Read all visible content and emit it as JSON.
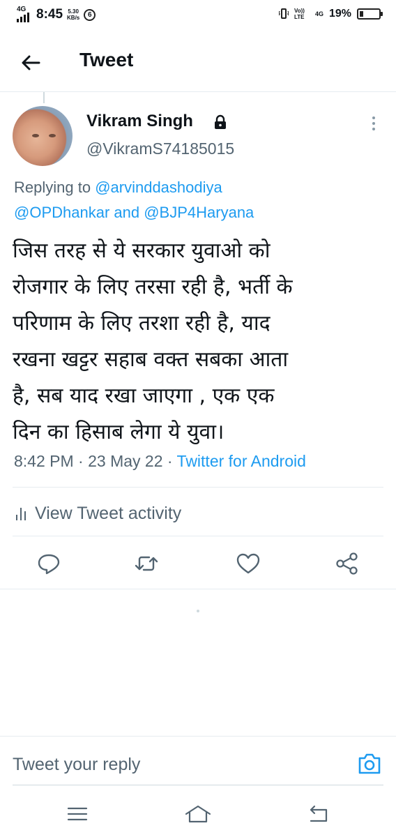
{
  "status_bar": {
    "network": "4G",
    "time": "8:45",
    "speed_value": "5.30",
    "speed_unit": "KB/s",
    "notification_count": "6",
    "volte": "Vo)) LTE",
    "network_right": "4G",
    "battery_percent": "19%",
    "battery_level": 0.19
  },
  "header": {
    "title": "Tweet"
  },
  "tweet": {
    "author_name": "Vikram Singh",
    "author_handle": "@VikramS74185015",
    "replying_prefix": "Replying to ",
    "replying_to": [
      "@arvinddashodiya",
      "@OPDhankar",
      "@BJP4Haryana"
    ],
    "replying_and": " and ",
    "text_lines": [
      "जिस तरह से ये सरकार युवाओ को",
      "रोजगार के लिए तरसा रही है, भर्ती के",
      "परिणाम के लिए तरशा रही है, याद",
      "रखना खट्टर सहाब वक्त सबका आता",
      "है, सब याद रखा जाएगा , एक एक",
      "दिन का हिसाब लेगा ये युवा।"
    ],
    "time": "8:42 PM",
    "date": "23 May 22",
    "separator": " · ",
    "source": "Twitter for Android"
  },
  "activity": {
    "label": "View Tweet activity"
  },
  "actions": [
    {
      "name": "reply",
      "icon": "reply-icon"
    },
    {
      "name": "retweet",
      "icon": "retweet-icon"
    },
    {
      "name": "like",
      "icon": "heart-icon"
    },
    {
      "name": "share",
      "icon": "share-icon"
    }
  ],
  "composer": {
    "placeholder": "Tweet your reply",
    "value": ""
  },
  "colors": {
    "accent": "#1d9bf0",
    "secondary_text": "#536471",
    "primary_text": "#0f1419",
    "divider": "#e6ecf0"
  }
}
